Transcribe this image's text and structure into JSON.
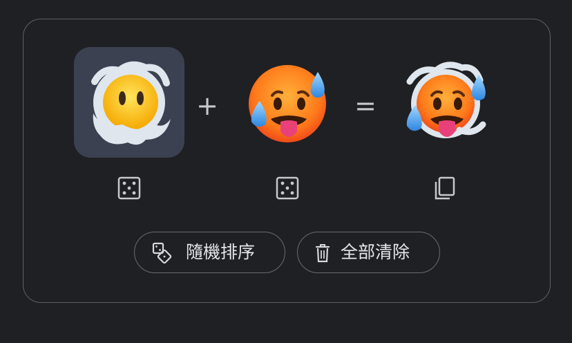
{
  "kitchen": {
    "left_emoji": {
      "name": "face-in-clouds",
      "selected": true
    },
    "plus_label": "+",
    "right_emoji": {
      "name": "hot-face-with-sweat"
    },
    "equals_label": "=",
    "result_emoji": {
      "name": "mashup-hot-face-in-clouds"
    },
    "left_dice_icon": "dice-icon",
    "right_dice_icon": "dice-icon",
    "copy_icon": "copy-icon"
  },
  "actions": {
    "shuffle_label": "隨機排序",
    "shuffle_icon": "dice-shuffle-icon",
    "clear_label": "全部清除",
    "clear_icon": "trash-icon"
  },
  "colors": {
    "background": "#1f2023",
    "card_border": "#5f6166",
    "selected_slot": "#3b4150",
    "text": "#e6e6e8"
  }
}
